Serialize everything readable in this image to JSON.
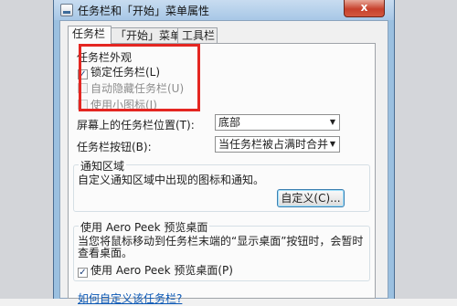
{
  "window": {
    "title": "任务栏和「开始」菜单属性",
    "close_glyph": "x"
  },
  "tabs": [
    {
      "label": "任务栏",
      "active": true
    },
    {
      "label": "「开始」菜单",
      "active": false
    },
    {
      "label": "工具栏",
      "active": false
    }
  ],
  "appearance": {
    "heading": "任务栏外观",
    "lock_taskbar": {
      "label": "锁定任务栏(L)",
      "checked": true,
      "enabled": true
    },
    "auto_hide": {
      "label": "自动隐藏任务栏(U)",
      "checked": false,
      "enabled": false
    },
    "small_icons": {
      "label": "使用小图标(I)",
      "checked": false,
      "enabled": false
    }
  },
  "position": {
    "label": "屏幕上的任务栏位置(T):",
    "value": "底部"
  },
  "buttons_setting": {
    "label": "任务栏按钮(B):",
    "value": "当任务栏被占满时合并"
  },
  "notification": {
    "heading": "通知区域",
    "description": "自定义通知区域中出现的图标和通知。",
    "customize_button": "自定义(C)..."
  },
  "aero_peek": {
    "heading": "使用 Aero Peek 预览桌面",
    "description_line1": "当您将鼠标移动到任务栏末端的“显示桌面”按钮时，会暂时",
    "description_line2": "查看桌面。",
    "checkbox": {
      "label": "使用 Aero Peek 预览桌面(P)",
      "checked": true
    }
  },
  "help_link": "如何自定义该任务栏?",
  "colors": {
    "highlight_border": "#e42621",
    "link": "#0b58b5"
  }
}
